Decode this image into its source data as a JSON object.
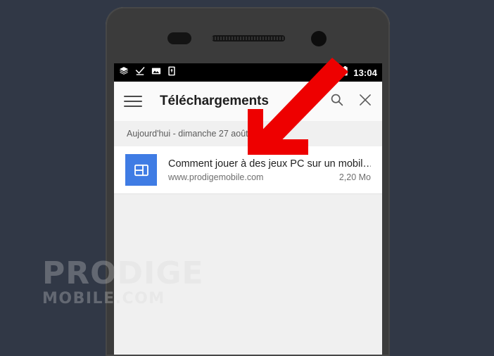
{
  "scene": {
    "background_color": "#313846",
    "device_body_color": "#3b3b3b"
  },
  "device": {
    "hardware": {
      "proximity_sensor": "proximity-sensor",
      "earpiece_speaker": "earpiece-speaker",
      "front_camera": "front-camera"
    }
  },
  "status_bar": {
    "background_color": "#000000",
    "left_icons": [
      {
        "name": "layers-icon",
        "label": "Layers"
      },
      {
        "name": "download-complete-icon",
        "label": "Download complete"
      },
      {
        "name": "image-icon",
        "label": "Screenshot"
      },
      {
        "name": "sd-card-icon",
        "label": "Storage"
      }
    ],
    "right_icons": [
      {
        "name": "signal-icon",
        "label": "Signal"
      },
      {
        "name": "battery-icon",
        "label": "Battery"
      }
    ],
    "clock": "13:04"
  },
  "toolbar": {
    "menu_label": "Menu",
    "title": "Téléchargements",
    "search_label": "Rechercher",
    "close_label": "Fermer",
    "background_color": "#fafafa"
  },
  "content": {
    "date_header": "Aujourd'hui - dimanche 27 août",
    "downloads": [
      {
        "title": "Comment jouer à des jeux PC sur un mobil…",
        "url": "www.prodigemobile.com",
        "size": "2,20 Mo",
        "thumb_color": "#3f7ce4",
        "thumb_icon": "webpage-icon"
      }
    ]
  },
  "watermark": {
    "line1": "PRODIGE",
    "line2": "MOBILE.COM"
  },
  "annotation": {
    "arrow": {
      "name": "red-arrow-annotation",
      "color": "#ee0000",
      "direction": "down-left",
      "points_to": "Comment jouer à des jeux PC sur un mobil…"
    }
  }
}
